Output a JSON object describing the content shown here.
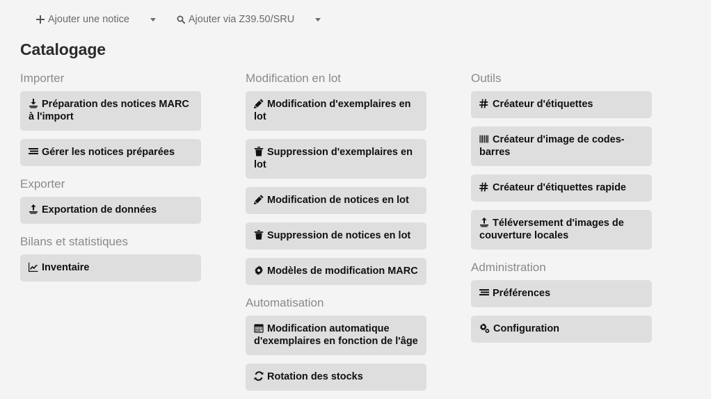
{
  "toolbar": {
    "buttons": [
      {
        "label": "Ajouter une notice",
        "icon": "plus-icon",
        "caret": true
      },
      {
        "label": "Ajouter via Z39.50/SRU",
        "icon": "search-icon",
        "caret": true
      }
    ]
  },
  "page": {
    "title": "Catalogage"
  },
  "columns": [
    {
      "name": "column-left",
      "sections": [
        {
          "heading": "Importer",
          "cards": [
            {
              "label": "Préparation des notices MARC à l'import",
              "icon": "download-icon"
            },
            {
              "label": "Gérer les notices préparées",
              "icon": "list-icon"
            }
          ]
        },
        {
          "heading": "Exporter",
          "cards": [
            {
              "label": "Exportation de données",
              "icon": "upload-icon"
            }
          ]
        },
        {
          "heading": "Bilans et statistiques",
          "cards": [
            {
              "label": "Inventaire",
              "icon": "chart-line-icon"
            }
          ]
        }
      ]
    },
    {
      "name": "column-middle",
      "sections": [
        {
          "heading": "Modification en lot",
          "cards": [
            {
              "label": "Modification d'exemplaires en lot",
              "icon": "pencil-icon"
            },
            {
              "label": "Suppression d'exemplaires en lot",
              "icon": "trash-icon"
            },
            {
              "label": "Modification de notices en lot",
              "icon": "pencil-icon"
            },
            {
              "label": "Suppression de notices en lot",
              "icon": "trash-icon"
            },
            {
              "label": "Modèles de modification MARC",
              "icon": "gear-icon"
            }
          ]
        },
        {
          "heading": "Automatisation",
          "cards": [
            {
              "label": "Modification automatique d'exemplaires en fonction de l'âge",
              "icon": "calendar-icon"
            },
            {
              "label": "Rotation des stocks",
              "icon": "refresh-icon"
            }
          ]
        }
      ]
    },
    {
      "name": "column-right",
      "sections": [
        {
          "heading": "Outils",
          "cards": [
            {
              "label": "Créateur d'étiquettes",
              "icon": "hashtag-icon"
            },
            {
              "label": "Créateur d'image de codes-barres",
              "icon": "barcode-icon"
            },
            {
              "label": "Créateur d'étiquettes rapide",
              "icon": "hashtag-icon"
            },
            {
              "label": "Téléversement d'images de couverture locales",
              "icon": "upload-icon"
            }
          ]
        },
        {
          "heading": "Administration",
          "cards": [
            {
              "label": "Préférences",
              "icon": "list-icon"
            },
            {
              "label": "Configuration",
              "icon": "cogs-icon"
            }
          ]
        }
      ]
    }
  ],
  "colors": {
    "page_background": "#f4f4f4",
    "card_background": "#dedede",
    "heading_text": "#8a8a8a",
    "card_text": "#101010",
    "title_text": "#2b2b2b",
    "toolbar_text": "#696969"
  }
}
